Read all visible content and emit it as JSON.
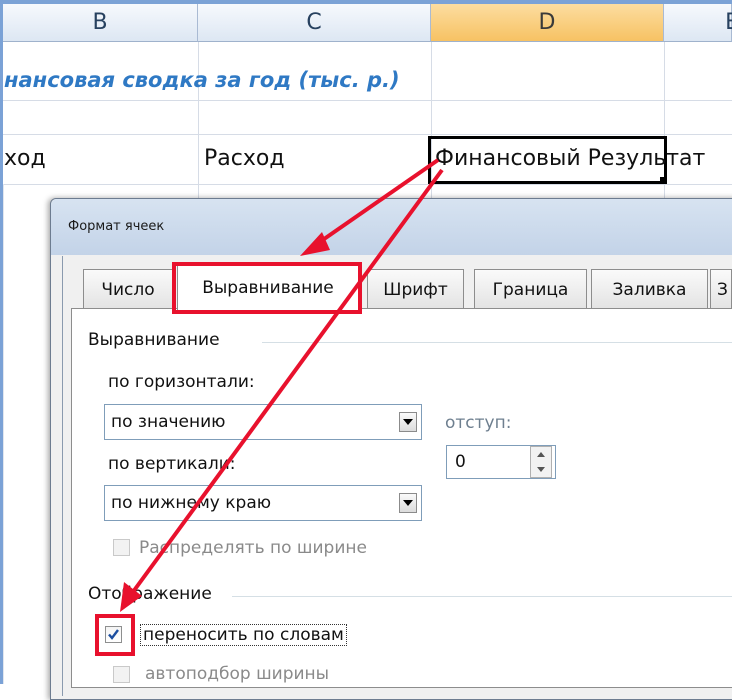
{
  "sheet": {
    "columns": [
      "B",
      "C",
      "D",
      "E"
    ],
    "selected_column": "D",
    "title_cell": "нансовая сводка за год (тыс. р.)",
    "row4": {
      "b": "ход",
      "c": "Расход",
      "d": "Финансовый Результат"
    }
  },
  "dialog": {
    "title": "Формат ячеек",
    "tabs": [
      "Число",
      "Выравнивание",
      "Шрифт",
      "Граница",
      "Заливка",
      "З"
    ],
    "active_tab": "Выравнивание",
    "alignment_group": "Выравнивание",
    "horizontal_label": "по горизонтали:",
    "horizontal_value": "по значению",
    "indent_label": "отступ:",
    "indent_value": "0",
    "vertical_label": "по вертикали:",
    "vertical_value": "по нижнему краю",
    "distribute_label": "Распределять по ширине",
    "display_group": "Отображение",
    "wrap_text_label": "переносить по словам",
    "wrap_text_checked": true,
    "shrink_to_fit_label": "автоподбор ширины"
  },
  "colors": {
    "header_selected": "#f7c263",
    "title_text": "#2f79c4",
    "highlight_red": "#e8112d"
  }
}
